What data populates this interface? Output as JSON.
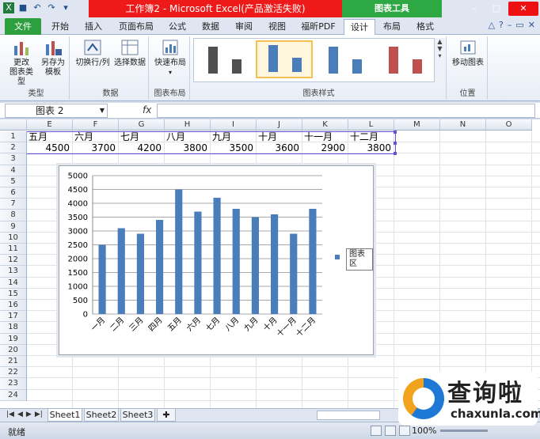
{
  "titlebar": {
    "title": "工作簿2 - Microsoft Excel(产品激活失败)",
    "context_tab": "图表工具"
  },
  "tabs": [
    "文件",
    "开始",
    "插入",
    "页面布局",
    "公式",
    "数据",
    "审阅",
    "视图",
    "福昕PDF",
    "设计",
    "布局",
    "格式"
  ],
  "active_tab": "设计",
  "ribbon": {
    "groups": [
      {
        "label": "类型",
        "buttons": [
          "更改\n图表类型",
          "另存为\n模板"
        ]
      },
      {
        "label": "数据",
        "buttons": [
          "切换行/列",
          "选择数据"
        ]
      },
      {
        "label": "图表布局",
        "buttons": [
          "快速布局"
        ]
      },
      {
        "label": "图表样式",
        "buttons": []
      },
      {
        "label": "位置",
        "buttons": [
          "移动图表"
        ]
      }
    ],
    "style_colors": [
      "#505050",
      "#4a7ebb",
      "#4a7ebb",
      "#c0504d"
    ]
  },
  "formula_bar": {
    "name_box": "图表  2",
    "fx_label": "fx",
    "value": ""
  },
  "columns": [
    "E",
    "F",
    "G",
    "H",
    "I",
    "J",
    "K",
    "L",
    "M",
    "N",
    "O"
  ],
  "rows": [
    "1",
    "2",
    "3",
    "4",
    "5",
    "6",
    "7",
    "8",
    "9",
    "10",
    "11",
    "12",
    "13",
    "14",
    "15",
    "16",
    "17",
    "18",
    "19",
    "20",
    "21",
    "22",
    "23",
    "24"
  ],
  "row1": [
    "五月",
    "六月",
    "七月",
    "八月",
    "九月",
    "十月",
    "十一月",
    "十二月"
  ],
  "row2": [
    "4500",
    "3700",
    "4200",
    "3800",
    "3500",
    "3600",
    "2900",
    "3800"
  ],
  "chart_data": {
    "type": "bar",
    "categories": [
      "一月",
      "二月",
      "三月",
      "四月",
      "五月",
      "六月",
      "七月",
      "八月",
      "九月",
      "十月",
      "十一月",
      "十二月"
    ],
    "series": [
      {
        "values": [
          2500,
          3100,
          2900,
          3400,
          4500,
          3700,
          4200,
          3800,
          3500,
          3600,
          2900,
          3800
        ]
      }
    ],
    "yticks": [
      "0",
      "500",
      "1000",
      "1500",
      "2000",
      "2500",
      "3000",
      "3500",
      "4000",
      "4500",
      "5000"
    ],
    "ylim": [
      0,
      5000
    ],
    "color": "#4a7ebb",
    "grid": true,
    "legend_position": "right"
  },
  "tooltip": "图表区",
  "sheets": [
    "Sheet1",
    "Sheet2",
    "Sheet3"
  ],
  "active_sheet": "Sheet1",
  "status": {
    "ready": "就绪",
    "zoom": "100%"
  },
  "watermark": {
    "cn": "查询啦",
    "en": "chaxunla.com"
  }
}
